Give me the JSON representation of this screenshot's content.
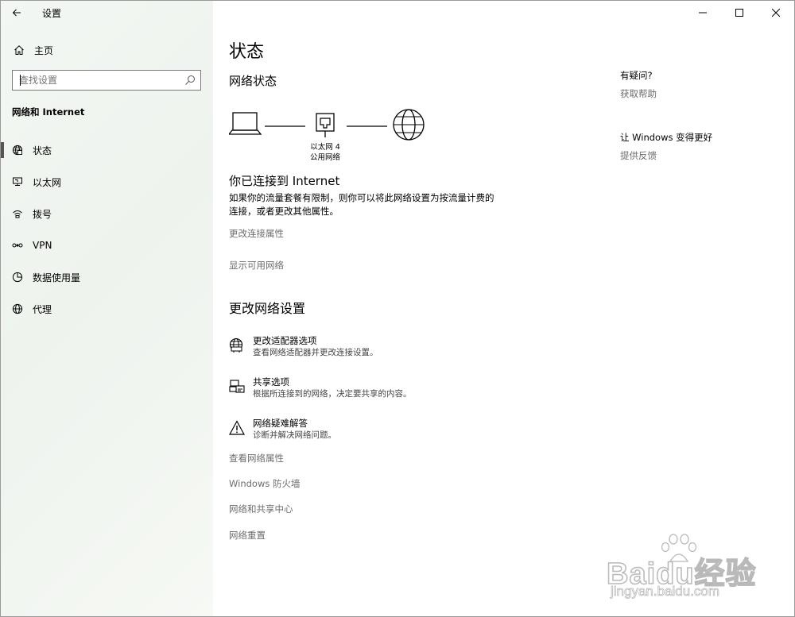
{
  "window": {
    "title": "设置",
    "controls": {
      "minimize_icon": "minimize-icon",
      "maximize_icon": "maximize-icon",
      "close_icon": "close-icon"
    }
  },
  "sidebar": {
    "home_label": "主页",
    "search_placeholder": "查找设置",
    "section_heading": "网络和 Internet",
    "items": [
      {
        "label": "状态",
        "icon": "globe-status-icon",
        "active": true
      },
      {
        "label": "以太网",
        "icon": "ethernet-icon",
        "active": false
      },
      {
        "label": "拨号",
        "icon": "dialup-icon",
        "active": false
      },
      {
        "label": "VPN",
        "icon": "vpn-icon",
        "active": false
      },
      {
        "label": "数据使用量",
        "icon": "data-usage-icon",
        "active": false
      },
      {
        "label": "代理",
        "icon": "proxy-globe-icon",
        "active": false
      }
    ]
  },
  "main": {
    "page_title": "状态",
    "network_status_heading": "网络状态",
    "diagram": {
      "adapter_name": "以太网 4",
      "network_type": "公用网络"
    },
    "connected_title": "你已连接到 Internet",
    "connected_desc_line1": "如果你的流量套餐有限制，则你可以将此网络设置为按流量计费的",
    "connected_desc_line2": "连接，或者更改其他属性。",
    "link_change_connection": "更改连接属性",
    "link_show_networks": "显示可用网络",
    "change_settings_heading": "更改网络设置",
    "settings": [
      {
        "title": "更改适配器选项",
        "desc": "查看网络适配器并更改连接设置。",
        "icon": "adapter-globe-icon"
      },
      {
        "title": "共享选项",
        "desc": "根据所连接到的网络，决定要共享的内容。",
        "icon": "sharing-icon"
      },
      {
        "title": "网络疑难解答",
        "desc": "诊断并解决网络问题。",
        "icon": "warning-icon"
      }
    ],
    "links": [
      "查看网络属性",
      "Windows 防火墙",
      "网络和共享中心",
      "网络重置"
    ]
  },
  "aside": {
    "help_heading": "有疑问?",
    "help_link": "获取帮助",
    "feedback_heading": "让 Windows 变得更好",
    "feedback_link": "提供反馈"
  },
  "watermark": {
    "brand": "Baidu经验",
    "url": "jingyan.baidu.com"
  }
}
